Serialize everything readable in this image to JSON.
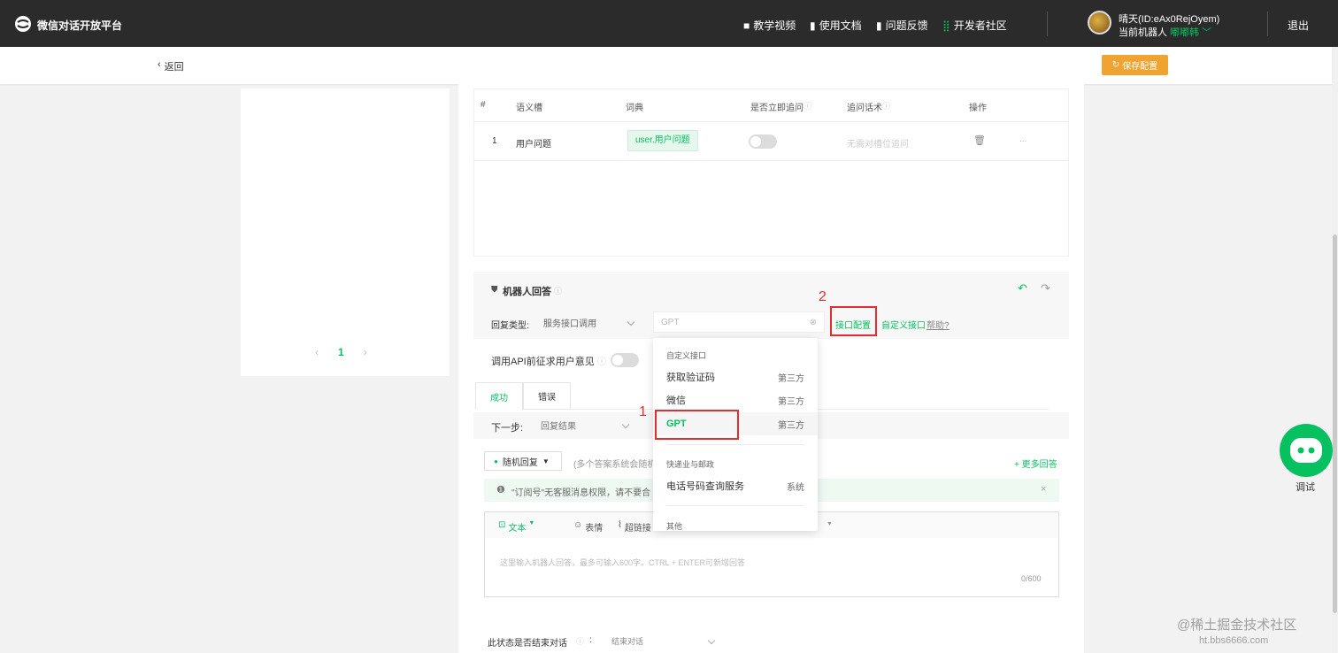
{
  "topbar": {
    "app_title": "微信对话开放平台",
    "nav": [
      "教学视频",
      "使用文档",
      "问题反馈",
      "开发者社区"
    ],
    "user_name": "晴天(ID:eAx0RejOyem)",
    "robot_prefix": "当前机器人",
    "robot_name": "嘟嘟韩",
    "logout": "退出"
  },
  "subbar": {
    "back": "返回",
    "save": "保存配置"
  },
  "left_panel": {
    "pagination": {
      "prev": "‹",
      "page": "1",
      "next": "›"
    }
  },
  "slot_table": {
    "headers": [
      "#",
      "语义槽",
      "词典",
      "是否立即追问",
      "追问话术",
      "操作"
    ],
    "rows": [
      {
        "index": "1",
        "slot": "用户问题",
        "dict": "user.用户问题",
        "followup_placeholder": "无需对槽位追问",
        "more": "..."
      }
    ]
  },
  "robot_answer": {
    "title": "机器人回答",
    "reply_type_label": "回复类型:",
    "reply_type_value": "服务接口调用",
    "api_value": "GPT",
    "interface_config": "接口配置",
    "custom_interface": "自定义接口",
    "help": "帮助?",
    "consult_label": "调用API前征求用户意见",
    "tabs": [
      "成功",
      "错误"
    ],
    "next_step_label": "下一步:",
    "next_step_value": "回复结果",
    "random_reply": "随机回复",
    "random_hint": "(多个答案系统会随机",
    "more_answers": "+ 更多回答",
    "notice": "\"订阅号\"无客服消息权限，请不要合",
    "editor": {
      "text_mode": "文本",
      "emoji": "表情",
      "link": "超链接",
      "placeholder": "这里输入机器人回答，最多可输入600字。CTRL + ENTER可新增回答",
      "counter": "0/600"
    },
    "end_conv_label": "此状态是否结束对话",
    "end_conv_value": "结束对话"
  },
  "dropdown": {
    "groups": [
      {
        "title": "自定义接口",
        "items": [
          {
            "name": "获取验证码",
            "tag": "第三方"
          },
          {
            "name": "微信",
            "tag": "第三方"
          },
          {
            "name": "GPT",
            "tag": "第三方"
          }
        ]
      },
      {
        "title": "快递业与邮政",
        "items": [
          {
            "name": "电话号码查询服务",
            "tag": "系统"
          }
        ]
      },
      {
        "title": "其他",
        "items": []
      }
    ]
  },
  "annotations": {
    "n1": "1",
    "n2": "2"
  },
  "debug_button": {
    "label": "调试"
  },
  "watermark": {
    "line1": "@稀土掘金技术社区",
    "line2": "ht.bbs6666.com"
  },
  "colors": {
    "brand_green": "#07c160",
    "save_orange": "#f0a330",
    "annotation_red": "#e52d2d",
    "topbar": "#2b2b2b"
  }
}
